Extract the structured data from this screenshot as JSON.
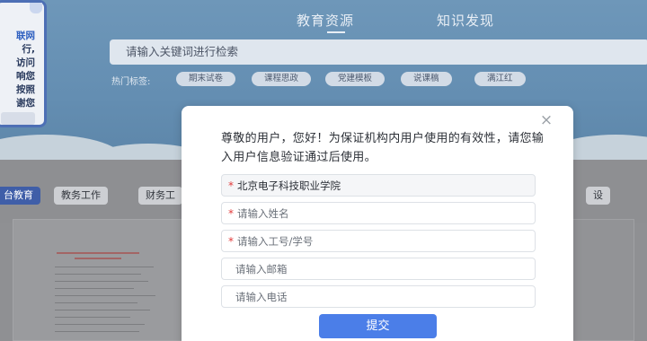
{
  "side_notice": {
    "lines": [
      "联网",
      "行,",
      "访问",
      "响您",
      "按照",
      "谢您"
    ]
  },
  "header": {
    "tabs": [
      {
        "label": "教育资源",
        "active": true
      },
      {
        "label": "知识发现",
        "active": false
      }
    ]
  },
  "search": {
    "placeholder": "请输入关键词进行检索"
  },
  "hot_tags": {
    "label": "热门标签:",
    "items": [
      "期末试卷",
      "课程思政",
      "党建模板",
      "说课稿",
      "满江红"
    ]
  },
  "categories": {
    "items": [
      {
        "label": "台教育",
        "active": true
      },
      {
        "label": "教务工作",
        "active": false
      },
      {
        "label": "财务工",
        "active": false
      },
      {
        "label": "设",
        "active": false
      }
    ]
  },
  "modal": {
    "message": "尊敬的用户，您好！为保证机构内用户使用的有效性，请您输入用户信息验证通过后使用。",
    "close_symbol": "×",
    "fields": {
      "institution": {
        "value": "北京电子科技职业学院",
        "required": true
      },
      "name": {
        "placeholder": "请输入姓名",
        "required": true
      },
      "id_number": {
        "placeholder": "请输入工号/学号",
        "required": true
      },
      "email": {
        "placeholder": "请输入邮箱",
        "required": false
      },
      "phone": {
        "placeholder": "请输入电话",
        "required": false
      }
    },
    "required_mark": "*",
    "submit_label": "提交"
  },
  "colors": {
    "hero_bg": "#648eb2",
    "submit_bg": "#4b7ee8",
    "required": "#e23b3b",
    "active_category": "#3f5ea8"
  }
}
